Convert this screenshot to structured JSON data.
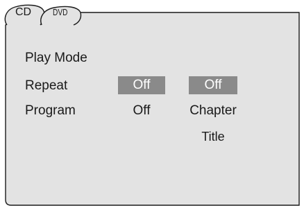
{
  "tabs": [
    {
      "label": "CD"
    },
    {
      "label": "DVD"
    }
  ],
  "menu": {
    "play_mode_label": "Play Mode",
    "repeat": {
      "label": "Repeat",
      "cd_value": "Off",
      "dvd_value": "Off"
    },
    "program": {
      "label": "Program",
      "cd_value": "Off",
      "dvd_options": [
        "Chapter",
        "Title"
      ]
    }
  },
  "colors": {
    "highlight": "#8a8a8a",
    "highlight_text": "#ffffff",
    "panel_background": "#e3e3e3",
    "border": "#1a1a1a"
  }
}
